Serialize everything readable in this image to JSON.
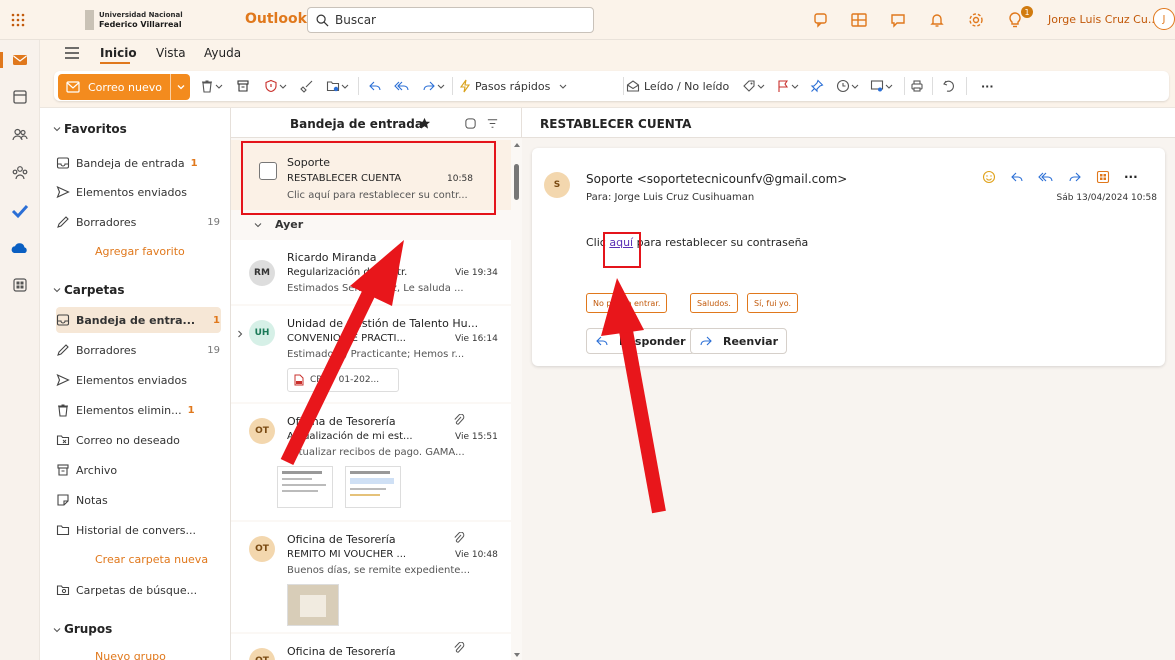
{
  "topbar": {
    "logo_line1": "Universidad Nacional",
    "logo_line2": "Federico Villarreal",
    "app_name": "Outlook",
    "search_placeholder": "Buscar",
    "user_name": "Jorge Luis Cruz Cu...",
    "avatar_initial": "J",
    "notification_count": "1"
  },
  "tabs": {
    "inicio": "Inicio",
    "vista": "Vista",
    "ayuda": "Ayuda"
  },
  "toolbar": {
    "new_mail": "Correo nuevo",
    "quick_steps": "Pasos rápidos",
    "read_unread": "Leído / No leído",
    "more": "···"
  },
  "folders": {
    "favorites_header": "Favoritos",
    "favorites": [
      {
        "label": "Bandeja de entrada",
        "count": "1"
      },
      {
        "label": "Elementos enviados",
        "count": ""
      },
      {
        "label": "Borradores",
        "count": "19"
      }
    ],
    "add_favorite": "Agregar favorito",
    "folders_header": "Carpetas",
    "folders": [
      {
        "label": "Bandeja de entra...",
        "count": "1"
      },
      {
        "label": "Borradores",
        "count": "19"
      },
      {
        "label": "Elementos enviados",
        "count": ""
      },
      {
        "label": "Elementos elimin...",
        "count": "1"
      },
      {
        "label": "Correo no deseado",
        "count": ""
      },
      {
        "label": "Archivo",
        "count": ""
      },
      {
        "label": "Notas",
        "count": ""
      },
      {
        "label": "Historial de convers...",
        "count": ""
      }
    ],
    "create_folder": "Crear carpeta nueva",
    "search_folders": "Carpetas de búsque...",
    "groups_header": "Grupos",
    "new_group": "Nuevo grupo"
  },
  "list": {
    "title": "Bandeja de entrada",
    "group_yesterday": "Ayer",
    "messages": [
      {
        "initials": "",
        "from": "Soporte",
        "subject": "RESTABLECER CUENTA",
        "time": "10:58",
        "preview": "Clic aquí para restablecer su contr..."
      },
      {
        "initials": "RM",
        "from": "Ricardo Miranda",
        "subject": "Regularización de contr...",
        "time": "Vie 19:34",
        "preview": "Estimados Señor Cruz, Le saluda ..."
      },
      {
        "initials": "UH",
        "from": "Unidad de Gestión de Talento Hu...",
        "subject": "CONVENIO DE PRACTI...",
        "time": "Vie 16:14",
        "preview": "Estimado(a) Practicante; Hemos r...",
        "attachment": "CP N° 01-202..."
      },
      {
        "initials": "OT",
        "from": "Oficina de Tesorería",
        "subject": "Actualización de mi est...",
        "time": "Vie 15:51",
        "preview": "actualizar recibos de pago. GAMA..."
      },
      {
        "initials": "OT",
        "from": "Oficina de Tesorería",
        "subject": "REMITO MI VOUCHER ...",
        "time": "Vie 10:48",
        "preview": "Buenos días, se remite expediente..."
      },
      {
        "initials": "OT",
        "from": "Oficina de Tesorería",
        "subject": "",
        "time": "",
        "preview": ""
      }
    ]
  },
  "reading": {
    "subject": "RESTABLECER CUENTA",
    "avatar_initial": "S",
    "from": "Soporte <soportetecnicounfv@gmail.com>",
    "to": "Para:  Jorge Luis Cruz Cusihuaman",
    "date": "Sáb 13/04/2024 10:58",
    "body_before": "Clic ",
    "body_link": "aquí",
    "body_after": " para restablecer su contraseña",
    "chips": [
      "No puedo entrar.",
      "Saludos.",
      "Sí, fui yo."
    ],
    "reply": "Responder",
    "forward": "Reenviar"
  },
  "colors": {
    "accent": "#e0781c",
    "annotation_red": "#e4141b"
  }
}
